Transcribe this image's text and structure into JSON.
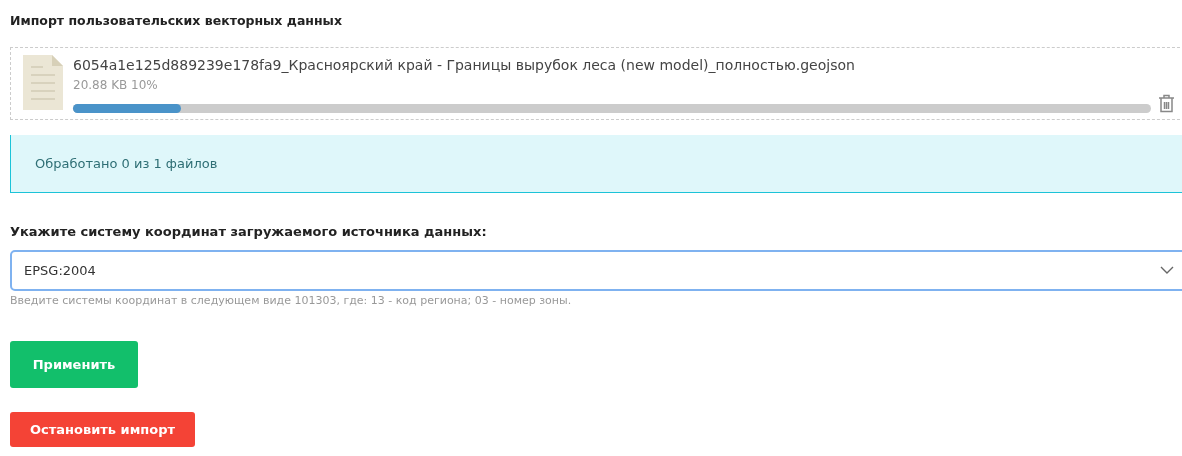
{
  "title": "Импорт пользовательских векторных данных",
  "upload": {
    "file_name": "6054a1e125d889239e178fa9_Красноярский край - Границы вырубок леса (new model)_полностью.geojson",
    "size_text": "20.88 KB 10%",
    "level": 0.1
  },
  "status": {
    "text": "Обработано 0 из 1 файлов"
  },
  "coordinates": {
    "label": "Укажите систему координат загружаемого источника данных:",
    "value": "EPSG:2004",
    "help": "Введите системы координат в следующем виде 101303, где: 13 - код региона; 03 - номер зоны."
  },
  "buttons": [
    {
      "label": "Применить",
      "kind": "apply"
    },
    {
      "label": "Остановить импорт",
      "kind": "stop"
    }
  ]
}
